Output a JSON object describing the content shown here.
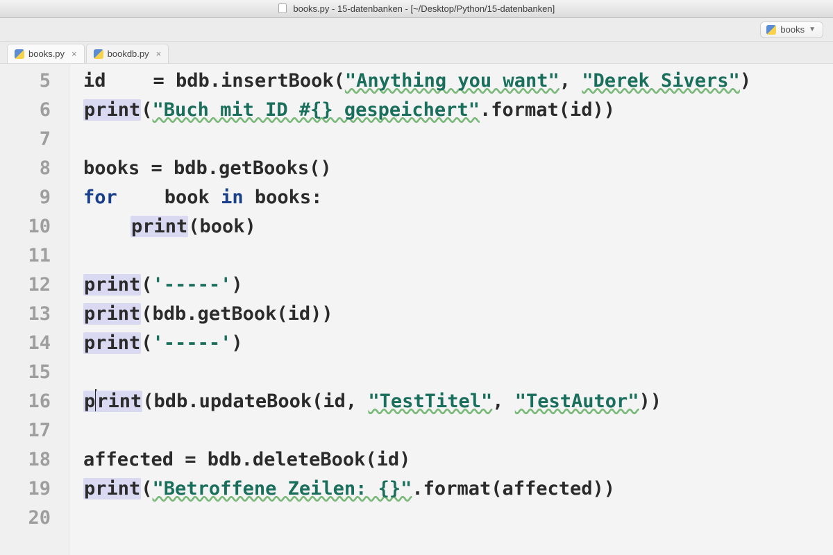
{
  "window": {
    "title": "books.py - 15-datenbanken - [~/Desktop/Python/15-datenbanken]"
  },
  "runconfig": {
    "name": "books"
  },
  "tabs": [
    {
      "name": "books.py",
      "active": true
    },
    {
      "name": "bookdb.py",
      "active": false
    }
  ],
  "code": {
    "first_line_number": 5,
    "lines": [
      {
        "n": 5,
        "t": "id = bdb.insertBook(\"Anything you want\", \"Derek Sivers\")"
      },
      {
        "n": 6,
        "t": "print(\"Buch mit ID #{} gespeichert\".format(id))"
      },
      {
        "n": 7,
        "t": ""
      },
      {
        "n": 8,
        "t": "books = bdb.getBooks()"
      },
      {
        "n": 9,
        "t": "for book in books:"
      },
      {
        "n": 10,
        "t": "    print(book)"
      },
      {
        "n": 11,
        "t": ""
      },
      {
        "n": 12,
        "t": "print('-----')"
      },
      {
        "n": 13,
        "t": "print(bdb.getBook(id))"
      },
      {
        "n": 14,
        "t": "print('-----')"
      },
      {
        "n": 15,
        "t": ""
      },
      {
        "n": 16,
        "t": "print(bdb.updateBook(id, \"TestTitel\", \"TestAutor\"))",
        "current": true
      },
      {
        "n": 17,
        "t": ""
      },
      {
        "n": 18,
        "t": "affected = bdb.deleteBook(id)"
      },
      {
        "n": 19,
        "t": "print(\"Betroffene Zeilen: {}\".format(affected))"
      },
      {
        "n": 20,
        "t": ""
      }
    ]
  },
  "syntax": {
    "keywords": [
      "for",
      "in"
    ],
    "builtins": [
      "print"
    ]
  }
}
